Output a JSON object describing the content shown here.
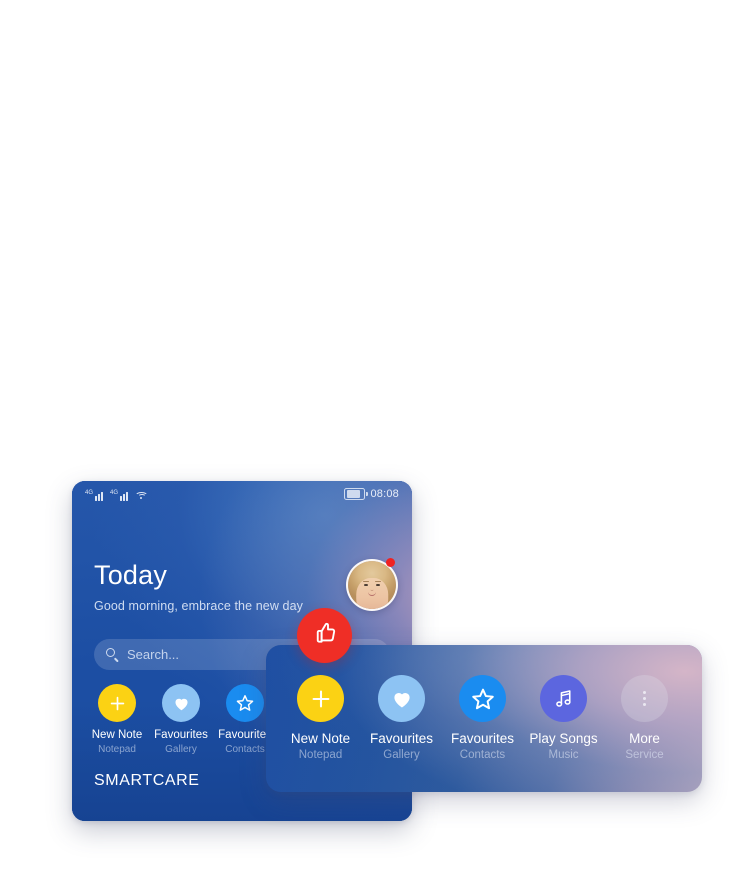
{
  "phone": {
    "status_bar": {
      "signal_1_label": "4G",
      "signal_2_label": "4G",
      "wifi_icon": "wifi-icon",
      "battery_icon": "battery-icon",
      "clock": "08:08"
    },
    "header": {
      "title": "Today",
      "subtitle": "Good morning, embrace the new day",
      "avatar_icon": "avatar",
      "notification_dot": "notification-dot"
    },
    "search": {
      "icon": "search-icon",
      "placeholder": "Search...",
      "value": ""
    },
    "apps": [
      {
        "label": "New Note",
        "sublabel": "Notepad",
        "icon": "plus-icon",
        "color": "#FBD214"
      },
      {
        "label": "Favourites",
        "sublabel": "Gallery",
        "icon": "heart-icon",
        "color": "#8DC3F3"
      },
      {
        "label": "Favourites",
        "sublabel": "Contacts",
        "icon": "star-icon",
        "color": "#1A8CF0"
      }
    ],
    "footer_label": "SMARTCARE"
  },
  "badge": {
    "icon": "thumbs-up-icon",
    "color": "#EF2E26"
  },
  "card": {
    "apps": [
      {
        "label": "New Note",
        "sublabel": "Notepad",
        "icon": "plus-icon",
        "color": "#FBD214"
      },
      {
        "label": "Favourites",
        "sublabel": "Gallery",
        "icon": "heart-icon",
        "color": "#8DC3F3"
      },
      {
        "label": "Favourites",
        "sublabel": "Contacts",
        "icon": "star-icon",
        "color": "#1A8CF0"
      },
      {
        "label": "Play Songs",
        "sublabel": "Music",
        "icon": "music-note-icon",
        "color": "#5C66DF"
      },
      {
        "label": "More",
        "sublabel": "Service",
        "icon": "more-dots-icon",
        "color": "rgba(222,222,232,0.30)"
      }
    ]
  }
}
